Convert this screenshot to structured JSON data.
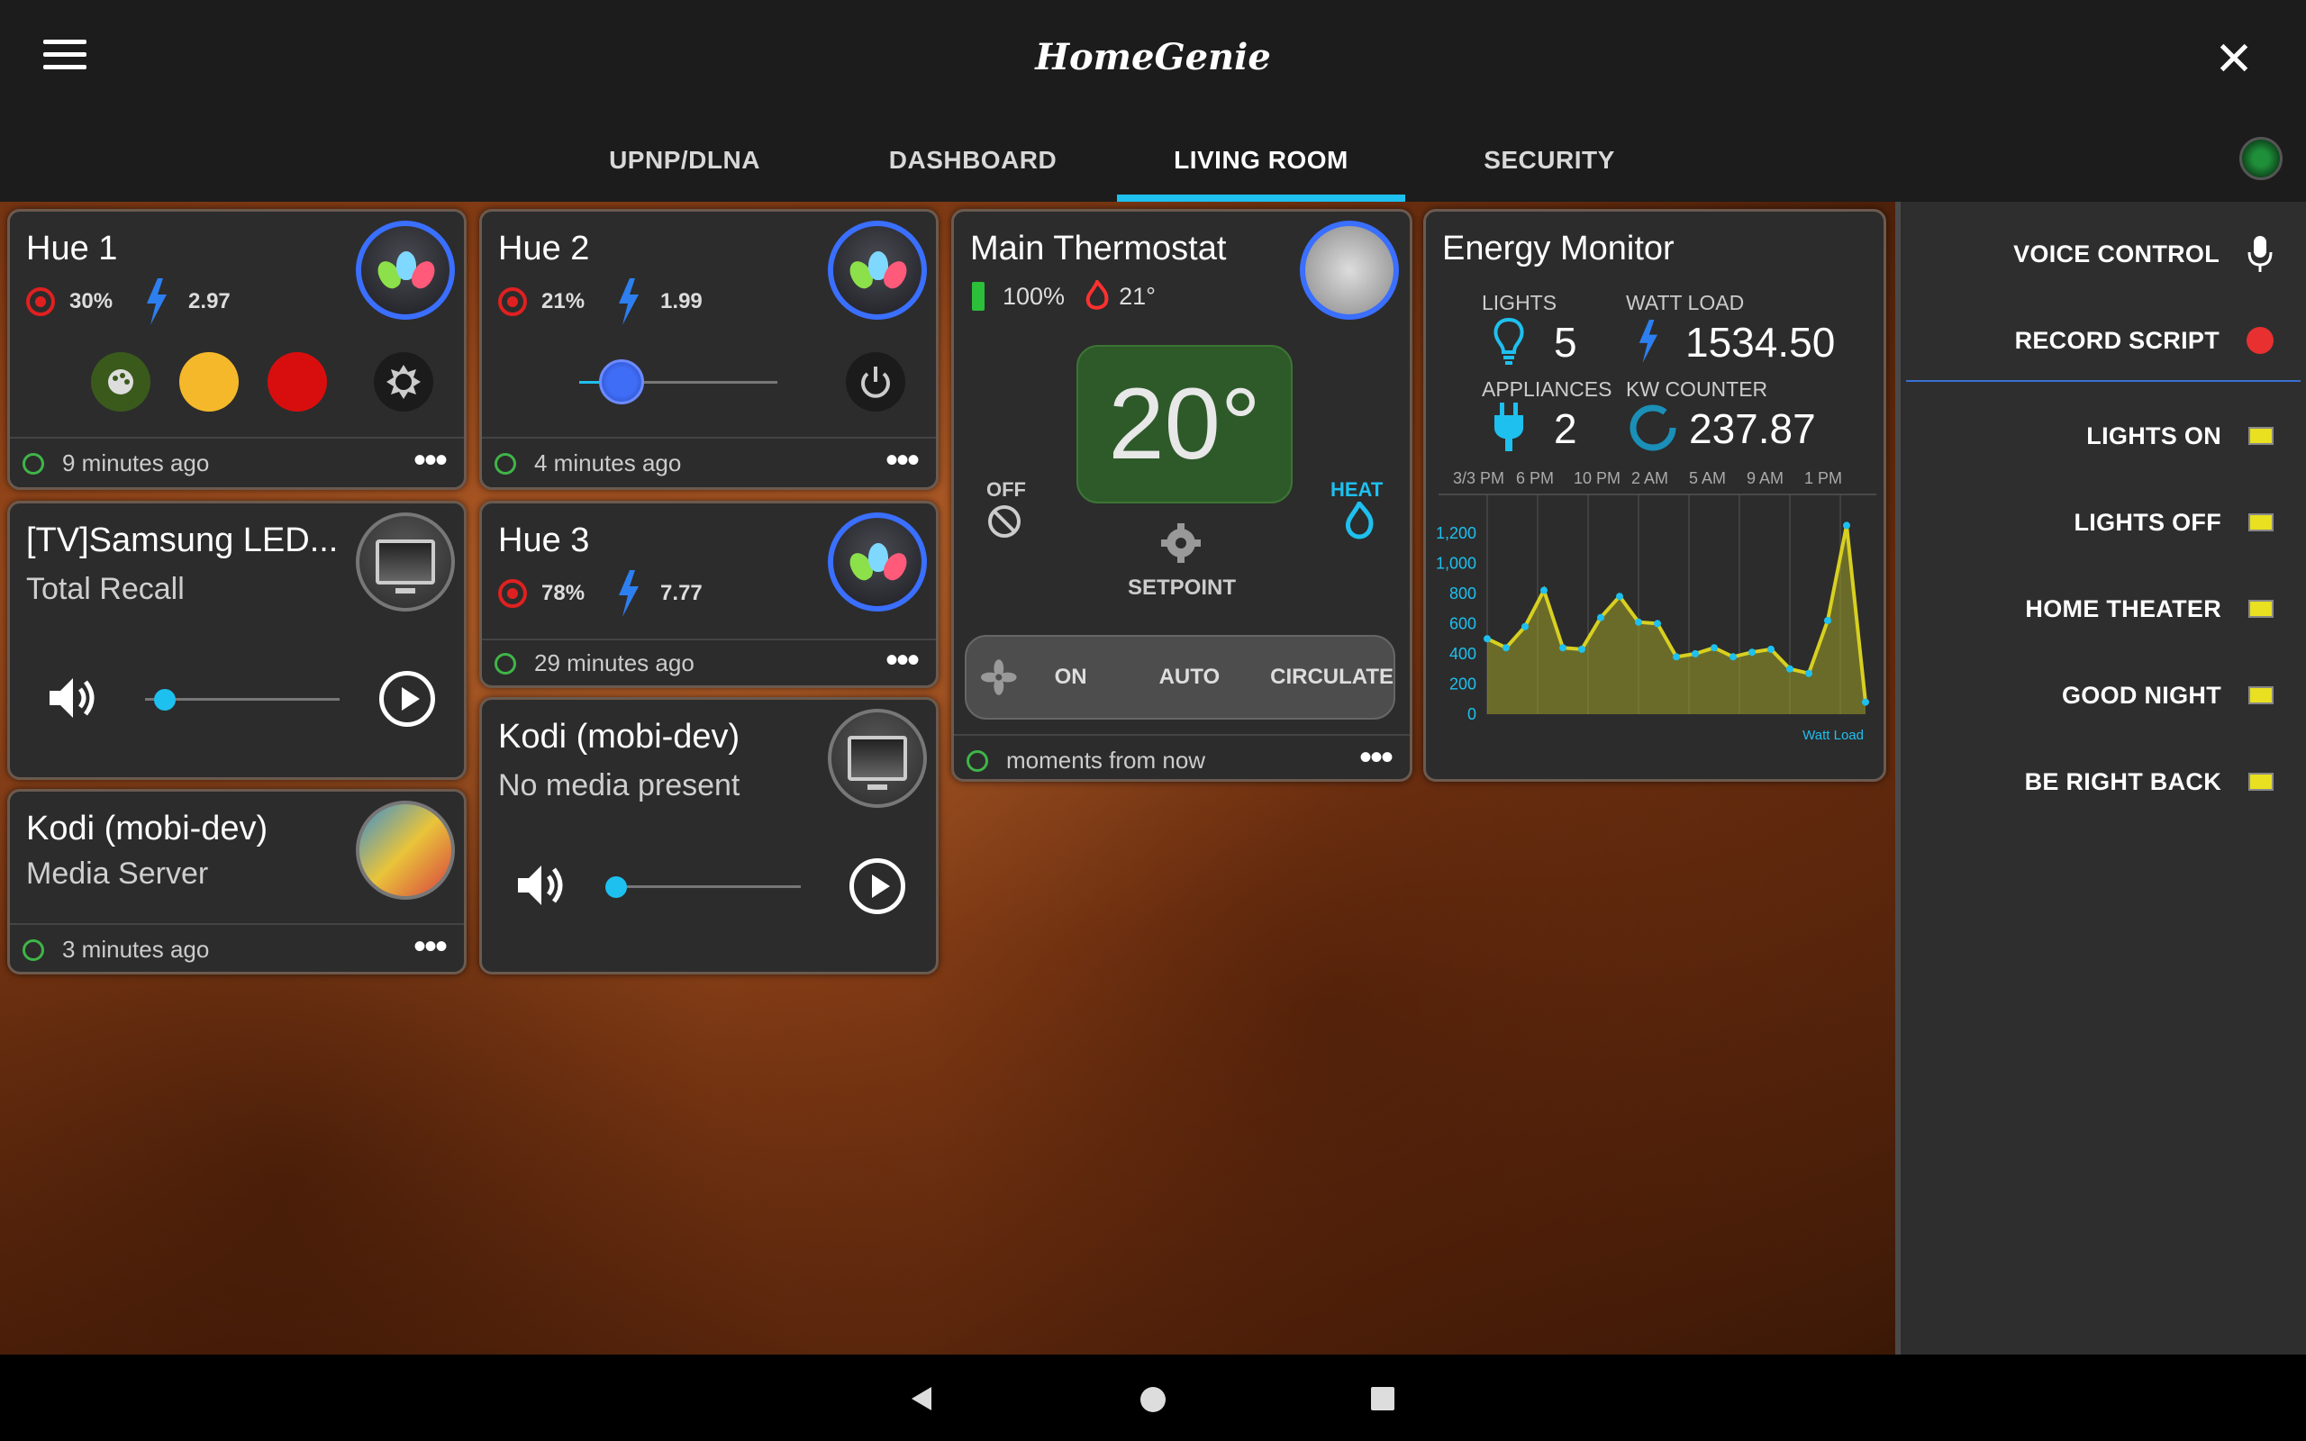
{
  "app": {
    "title": "HomeGenie",
    "close": "✕"
  },
  "tabs": [
    "UPNP/DLNA",
    "DASHBOARD",
    "LIVING ROOM",
    "SECURITY"
  ],
  "active_tab": "LIVING ROOM",
  "widgets": {
    "hue1": {
      "title": "Hue 1",
      "level": "30%",
      "power": "2.97",
      "updated": "9 minutes ago"
    },
    "hue2": {
      "title": "Hue 2",
      "level": "21%",
      "power": "1.99",
      "updated": "4 minutes ago",
      "level_fraction": 0.21
    },
    "hue3": {
      "title": "Hue 3",
      "level": "78%",
      "power": "7.77",
      "updated": "29 minutes ago"
    },
    "samsung": {
      "title": "[TV]Samsung LED...",
      "subtitle": "Total Recall",
      "volume_fraction": 0.1
    },
    "kodi_media": {
      "title": "Kodi (mobi-dev)",
      "subtitle": "Media Server",
      "updated": "3 minutes ago"
    },
    "kodi_player": {
      "title": "Kodi (mobi-dev)",
      "subtitle": "No media present",
      "volume_fraction": 0.05
    },
    "thermostat": {
      "title": "Main Thermostat",
      "battery": "100%",
      "temperature": "21°",
      "setpoint": "20°",
      "setpoint_label": "SETPOINT",
      "off_label": "OFF",
      "heat_label": "HEAT",
      "fan_modes": [
        "ON",
        "AUTO",
        "CIRCULATE"
      ],
      "updated": "moments from now"
    },
    "energy": {
      "title": "Energy Monitor",
      "lights_label": "LIGHTS",
      "lights_value": "5",
      "watt_label": "WATT LOAD",
      "watt_value": "1534.50",
      "appliances_label": "APPLIANCES",
      "appliances_value": "2",
      "kw_label": "KW COUNTER",
      "kw_value": "237.87"
    }
  },
  "chart_data": {
    "type": "area",
    "x_ticks": [
      "3/3 PM",
      "6 PM",
      "10 PM",
      "2 AM",
      "5 AM",
      "9 AM",
      "1 PM"
    ],
    "y_ticks": [
      "1,200",
      "1,000",
      "800",
      "600",
      "400",
      "200",
      "0"
    ],
    "ylim": [
      0,
      1300
    ],
    "legend": "Watt Load",
    "series": [
      {
        "name": "Watt Load",
        "values": [
          500,
          440,
          580,
          820,
          440,
          430,
          640,
          780,
          610,
          600,
          380,
          400,
          440,
          380,
          410,
          430,
          300,
          270,
          620,
          1250,
          80
        ]
      }
    ]
  },
  "side_panel": {
    "voice": "VOICE CONTROL",
    "record": "RECORD SCRIPT",
    "scenes": [
      "LIGHTS ON",
      "LIGHTS OFF",
      "HOME THEATER",
      "GOOD NIGHT",
      "BE RIGHT BACK"
    ]
  },
  "colors": {
    "accent": "#1ec0ef",
    "hue_ring": "#3a6fff",
    "red": "#e02020",
    "scene_box": "#e8e020"
  }
}
